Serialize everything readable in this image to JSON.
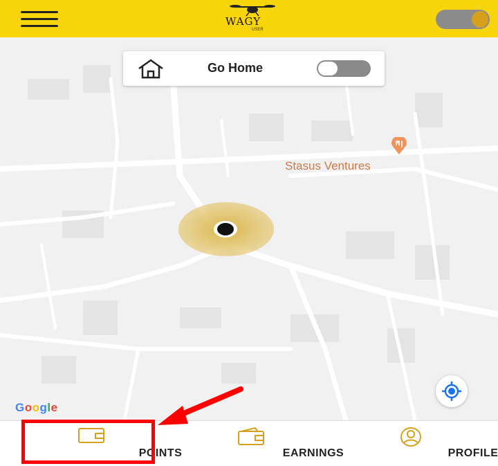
{
  "header": {
    "logo_text": "WAGY",
    "logo_sub": "USER",
    "toggle_state": "on"
  },
  "go_home": {
    "label": "Go Home",
    "toggle_state": "off"
  },
  "map": {
    "poi_label": "Stasus Ventures",
    "attribution": [
      "G",
      "o",
      "o",
      "g",
      "l",
      "e"
    ],
    "attribution_colors": [
      "#4285f4",
      "#ea4335",
      "#fbbc05",
      "#4285f4",
      "#34a853",
      "#ea4335"
    ]
  },
  "bottom_nav": {
    "items": [
      {
        "label": "POINTS"
      },
      {
        "label": "EARNINGS"
      },
      {
        "label": "PROFILE"
      }
    ]
  },
  "colors": {
    "brand_yellow": "#f8d40a",
    "accent_gold": "#d6a01c",
    "highlight_red": "#ff0000",
    "poi_orange": "#f0925a"
  }
}
